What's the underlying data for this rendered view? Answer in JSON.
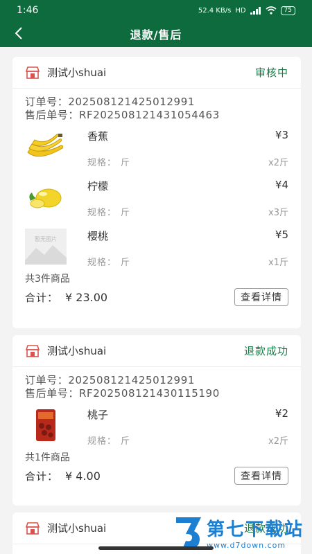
{
  "status_bar": {
    "time": "1:46",
    "network_speed": "52.4 KB/s",
    "network_type": "HD",
    "battery": "75"
  },
  "nav": {
    "title": "退款/售后"
  },
  "orders": [
    {
      "shop": "测试小shuai",
      "status": "审核中",
      "order_no": "订单号：202508121425012991",
      "after_sale_no": "售后单号：RF202508121431054463",
      "items": [
        {
          "name": "香蕉",
          "price": "¥3",
          "spec_label": "规格：",
          "spec_value": "斤",
          "qty": "x2斤",
          "thumb": "banana-image"
        },
        {
          "name": "柠檬",
          "price": "¥4",
          "spec_label": "规格：",
          "spec_value": "斤",
          "qty": "x3斤",
          "thumb": "lemon-image"
        },
        {
          "name": "樱桃",
          "price": "¥5",
          "spec_label": "规格：",
          "spec_value": "斤",
          "qty": "x1斤",
          "thumb": "no-image-placeholder",
          "placeholder_text": "暂无图片"
        }
      ],
      "count": "共3件商品",
      "total_label": "合计：",
      "total_value": "¥ 23.00",
      "detail_label": "查看详情"
    },
    {
      "shop": "测试小shuai",
      "status": "退款成功",
      "order_no": "订单号：202508121425012991",
      "after_sale_no": "售后单号：RF202508121430115190",
      "items": [
        {
          "name": "桃子",
          "price": "¥2",
          "spec_label": "规格：",
          "spec_value": "斤",
          "qty": "x2斤",
          "thumb": "peach-package-image"
        }
      ],
      "count": "共1件商品",
      "total_label": "合计：",
      "total_value": "¥ 4.00",
      "detail_label": "查看详情"
    },
    {
      "shop": "测试小shuai",
      "status": "退款成功"
    }
  ],
  "watermark": {
    "title": "第七下载站",
    "url": "www.d7down.com"
  },
  "colors": {
    "primary": "#0e6b3d",
    "status_text": "#167a45",
    "shop_icon": "#d9534f",
    "watermark": "#1d7fd1"
  }
}
